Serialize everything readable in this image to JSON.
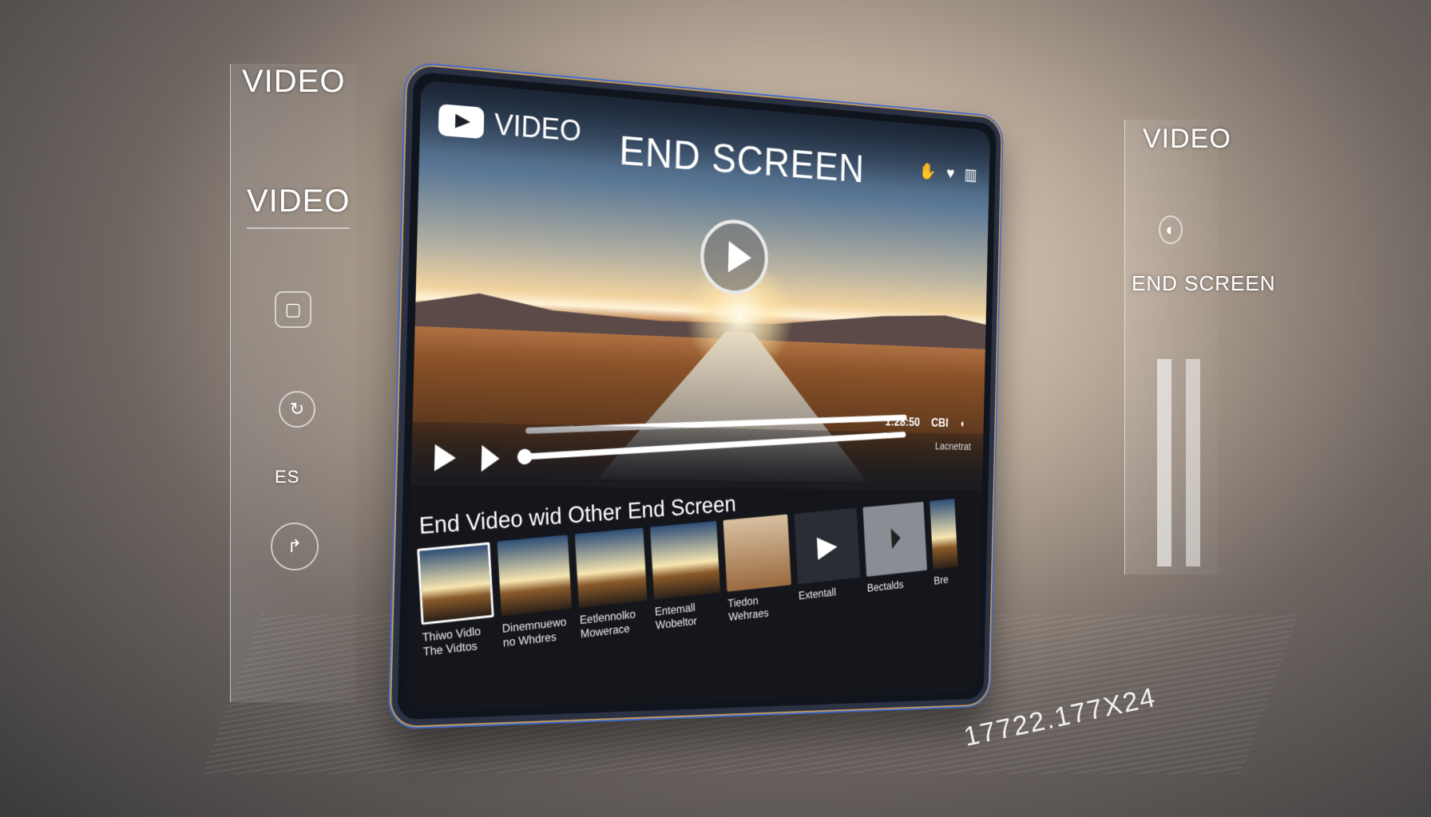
{
  "left_panel": {
    "label_top": "VIDEO",
    "label_mid": "VIDEO",
    "small_text": "ES",
    "icons": [
      "app-icon",
      "refresh-icon",
      "share-icon"
    ]
  },
  "right_panel": {
    "label_top": "VIDEO",
    "label_bottom": "END SCREEN",
    "icons": [
      "circle-logo-icon"
    ]
  },
  "header": {
    "logo_text": "VIDEO",
    "title": "END SCREEN",
    "icons": [
      "hand-icon",
      "heart-icon",
      "grid-icon"
    ]
  },
  "player": {
    "time": "1:28:50",
    "quality": "CBI",
    "secondary_label": "Lacnetrat",
    "icons": [
      "play-icon",
      "next-icon",
      "volume-icon"
    ]
  },
  "end_screen": {
    "heading": "End Video wid Other End Screen",
    "items": [
      {
        "caption": "Thiwo Vidlo The Vidtos",
        "selected": true
      },
      {
        "caption": "Dinemnuewo no Whdres"
      },
      {
        "caption": "Eetlennolko Mowerace"
      },
      {
        "caption": "Entemall Wobeltor"
      },
      {
        "caption": "Tiedon Wehraes"
      },
      {
        "caption": "Extentall",
        "type": "play"
      },
      {
        "caption": "Bectalds",
        "type": "play-circle"
      },
      {
        "caption": "Bre"
      }
    ]
  },
  "footer_stamp": "17722.177X24",
  "colors": {
    "accent_gold": "#c89a5a",
    "accent_blue": "#3b6ad0",
    "screen_bg": "#14161c"
  }
}
